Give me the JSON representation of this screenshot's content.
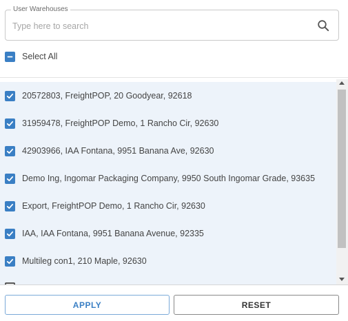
{
  "search": {
    "legend": "User Warehouses",
    "placeholder": "Type here to search",
    "value": ""
  },
  "select_all": {
    "label": "Select All",
    "checked": true
  },
  "warehouses": [
    {
      "label": "20572803, FreightPOP, 20 Goodyear, 92618",
      "checked": true
    },
    {
      "label": "31959478, FreightPOP Demo, 1 Rancho Cir, 92630",
      "checked": true
    },
    {
      "label": "42903966, IAA Fontana, 9951 Banana Ave, 92630",
      "checked": true
    },
    {
      "label": "Demo Ing, Ingomar Packaging Company, 9950 South Ingomar Grade, 93635",
      "checked": true
    },
    {
      "label": "Export, FreightPOP Demo, 1 Rancho Cir, 92630",
      "checked": true
    },
    {
      "label": "IAA, IAA Fontana, 9951 Banana Avenue, 92335",
      "checked": true
    },
    {
      "label": "Multileg con1, 210 Maple, 92630",
      "checked": true
    }
  ],
  "buttons": {
    "apply": "APPLY",
    "reset": "RESET"
  },
  "colors": {
    "accent": "#3a7fc4",
    "list_background": "#edf3fa"
  },
  "icons": {
    "search": "search-icon",
    "checkbox": "check-icon"
  }
}
